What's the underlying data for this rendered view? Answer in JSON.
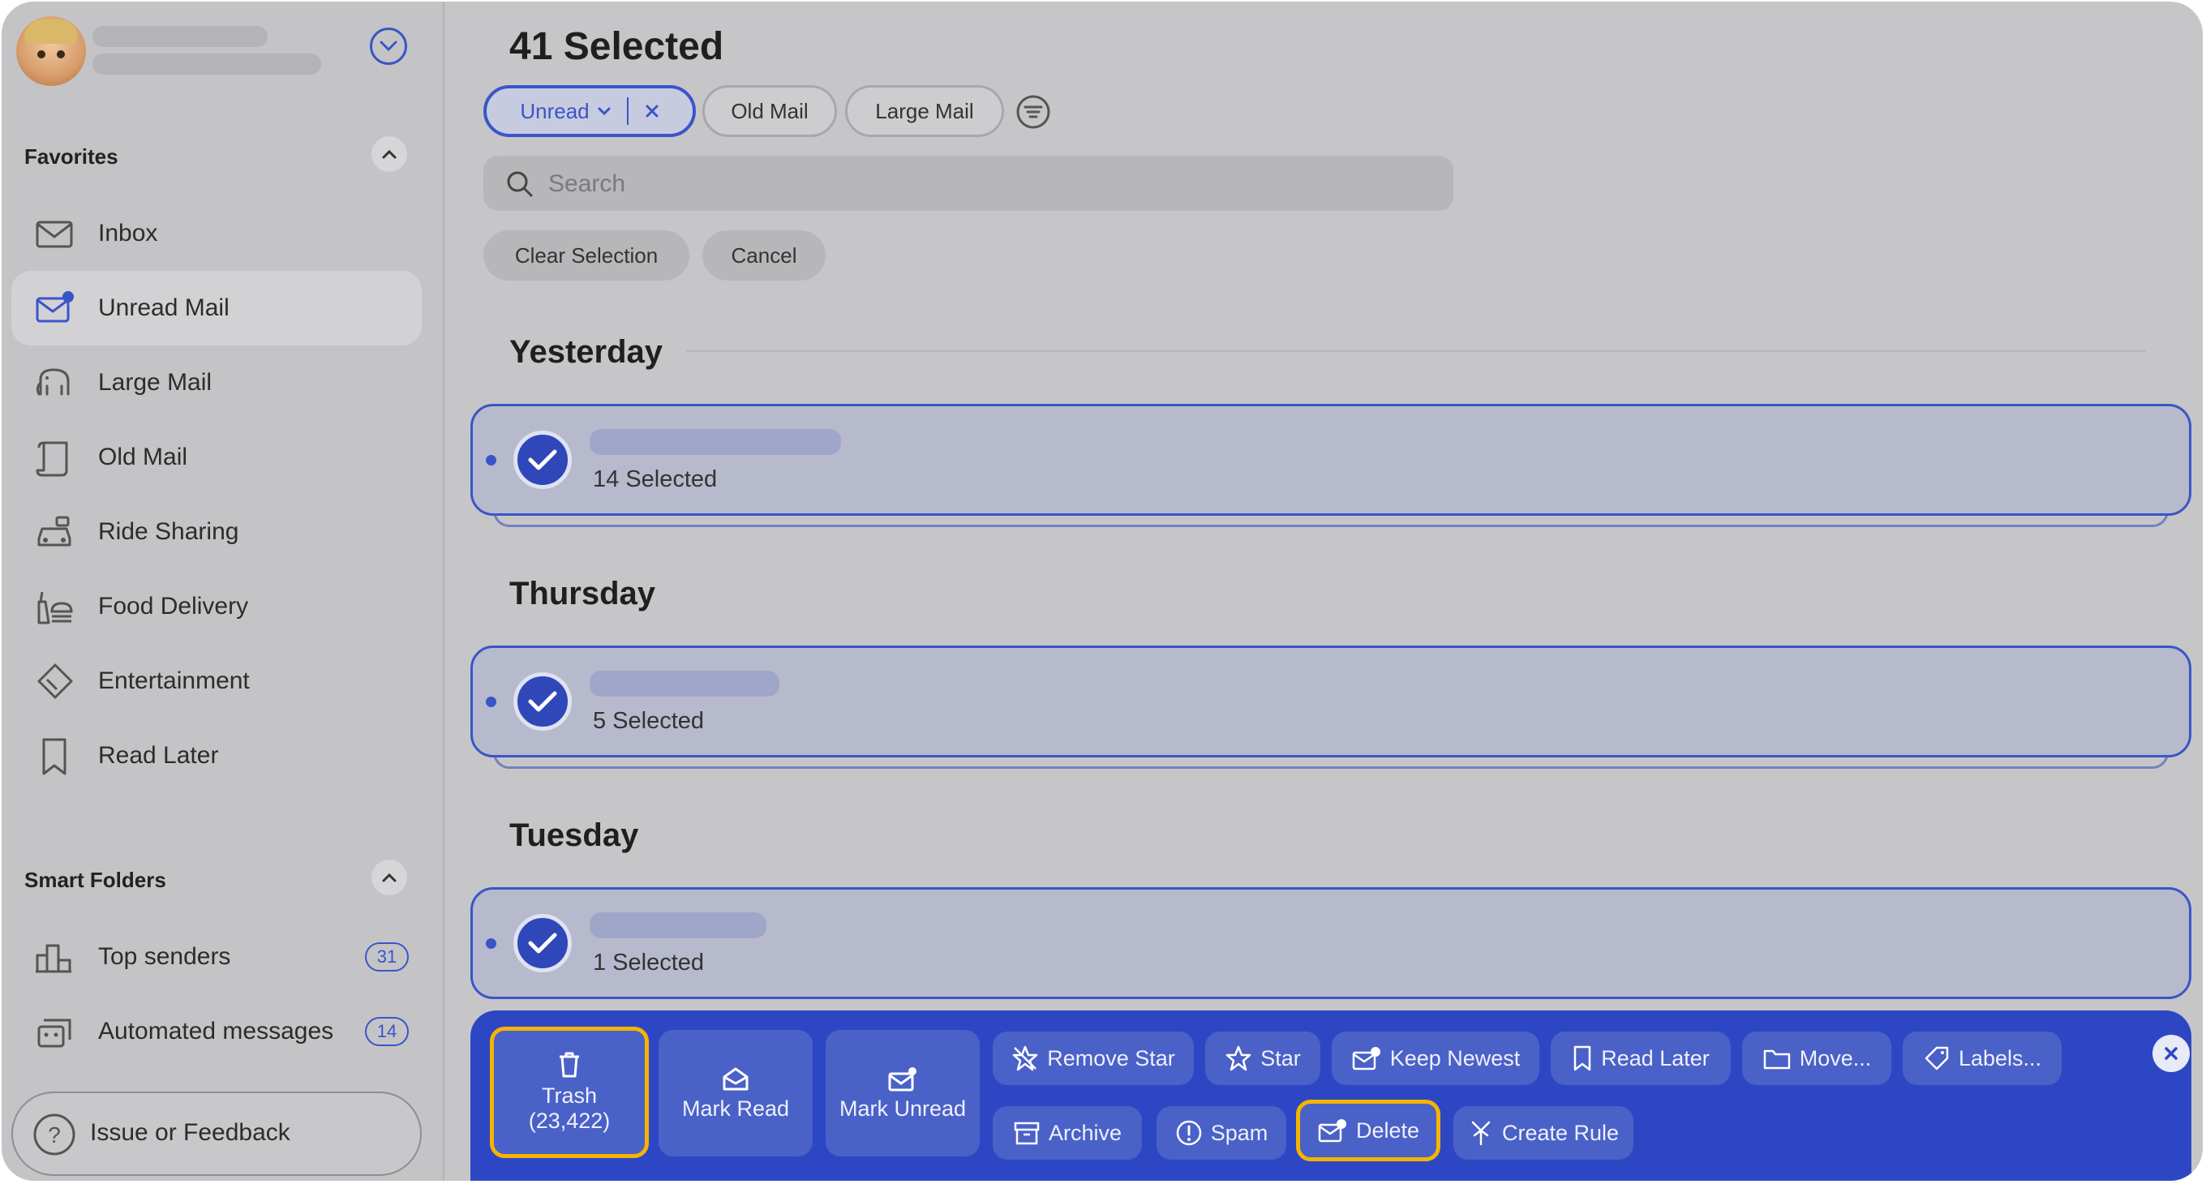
{
  "sidebar": {
    "favorites_title": "Favorites",
    "smart_folders_title": "Smart Folders",
    "favorites": [
      {
        "label": "Inbox",
        "icon": "inbox-icon"
      },
      {
        "label": "Unread Mail",
        "icon": "unread-mail-icon",
        "active": true
      },
      {
        "label": "Large Mail",
        "icon": "elephant-icon"
      },
      {
        "label": "Old Mail",
        "icon": "scroll-icon"
      },
      {
        "label": "Ride Sharing",
        "icon": "car-icon"
      },
      {
        "label": "Food Delivery",
        "icon": "food-icon"
      },
      {
        "label": "Entertainment",
        "icon": "ticket-icon"
      },
      {
        "label": "Read Later",
        "icon": "bookmark-icon"
      }
    ],
    "smart_folders": [
      {
        "label": "Top senders",
        "count": "31",
        "icon": "bar-chart-icon"
      },
      {
        "label": "Automated messages",
        "count": "14",
        "icon": "robot-icon"
      }
    ],
    "feedback_label": "Issue or Feedback"
  },
  "main": {
    "title": "41 Selected",
    "filters": [
      {
        "label": "Unread",
        "selected": true
      },
      {
        "label": "Old Mail"
      },
      {
        "label": "Large Mail"
      }
    ],
    "search_placeholder": "Search",
    "clear_selection": "Clear Selection",
    "cancel": "Cancel",
    "groups": [
      {
        "day": "Yesterday",
        "count_label": "14 Selected"
      },
      {
        "day": "Thursday",
        "count_label": "5 Selected"
      },
      {
        "day": "Tuesday",
        "count_label": "1 Selected"
      }
    ]
  },
  "actions": {
    "trash": "Trash",
    "trash_count": "(23,422)",
    "mark_read": "Mark Read",
    "mark_unread": "Mark Unread",
    "remove_star": "Remove Star",
    "star": "Star",
    "keep_newest": "Keep Newest",
    "read_later": "Read Later",
    "move": "Move...",
    "labels": "Labels...",
    "archive": "Archive",
    "spam": "Spam",
    "delete": "Delete",
    "create_rule": "Create Rule"
  },
  "colors": {
    "accent": "#3a55c8",
    "action_bar": "#2d47c4",
    "highlight": "#f5b400"
  }
}
